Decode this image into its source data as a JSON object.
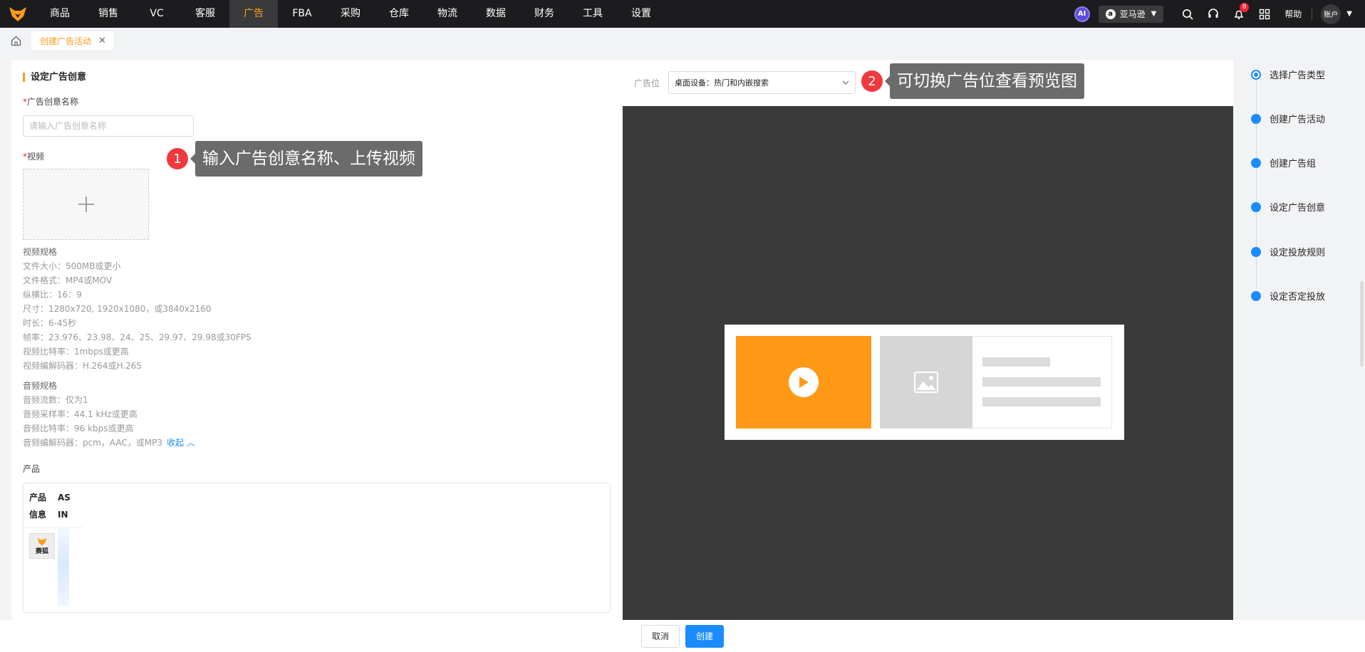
{
  "nav": {
    "items": [
      "商品",
      "销售",
      "VC",
      "客服",
      "广告",
      "FBA",
      "采购",
      "仓库",
      "物流",
      "数据",
      "财务",
      "工具",
      "设置"
    ],
    "active_index": 4,
    "ai_label": "AI",
    "store": "亚马逊",
    "notifications": "8",
    "help": "帮助",
    "account": "账户"
  },
  "tabs": {
    "current": "创建广告活动"
  },
  "form": {
    "section_title": "设定广告创意",
    "name_label": "广告创意名称",
    "name_placeholder": "请输入广告创意名称",
    "video_label": "视频",
    "video_specs_title": "视频规格",
    "video_specs": [
      "文件大小：500MB或更小",
      "文件格式：MP4或MOV",
      "纵横比：16：9",
      "尺寸：1280x720, 1920x1080，或3840x2160",
      "时长：6-45秒",
      "帧率：23.976、23.98、24、25、29.97、29.98或30FPS",
      "视频比特率：1mbps或更高",
      "视频编解码器：H.264或H.265"
    ],
    "audio_specs_title": "音频规格",
    "audio_specs": [
      "音频流数：仅为1",
      "音频采样率：44.1 kHz或更高",
      "音频比特率：96 kbps或更高",
      "音频编解码器：pcm，AAC，或MP3"
    ],
    "collapse_link": "收起",
    "product_label": "产品",
    "product_table": {
      "col1": [
        "产品",
        "信息"
      ],
      "col2": [
        "AS",
        "IN"
      ],
      "thumb_text": "赛狐"
    }
  },
  "annotations": {
    "one": {
      "num": "1",
      "text": "输入广告创意名称、上传视频"
    },
    "two": {
      "num": "2",
      "text": "可切换广告位查看预览图"
    }
  },
  "preview": {
    "position_label": "广告位",
    "position_value": "桌面设备：热门和内嵌搜索"
  },
  "steps": [
    "选择广告类型",
    "创建广告活动",
    "创建广告组",
    "设定广告创意",
    "设定投放规则",
    "设定否定投放"
  ],
  "footer": {
    "cancel": "取消",
    "create": "创建"
  },
  "colors": {
    "accent": "#ff9b1a",
    "primary": "#1a8cff",
    "annotation_red": "#f0383d",
    "preview_bg": "#3a3a3a"
  }
}
